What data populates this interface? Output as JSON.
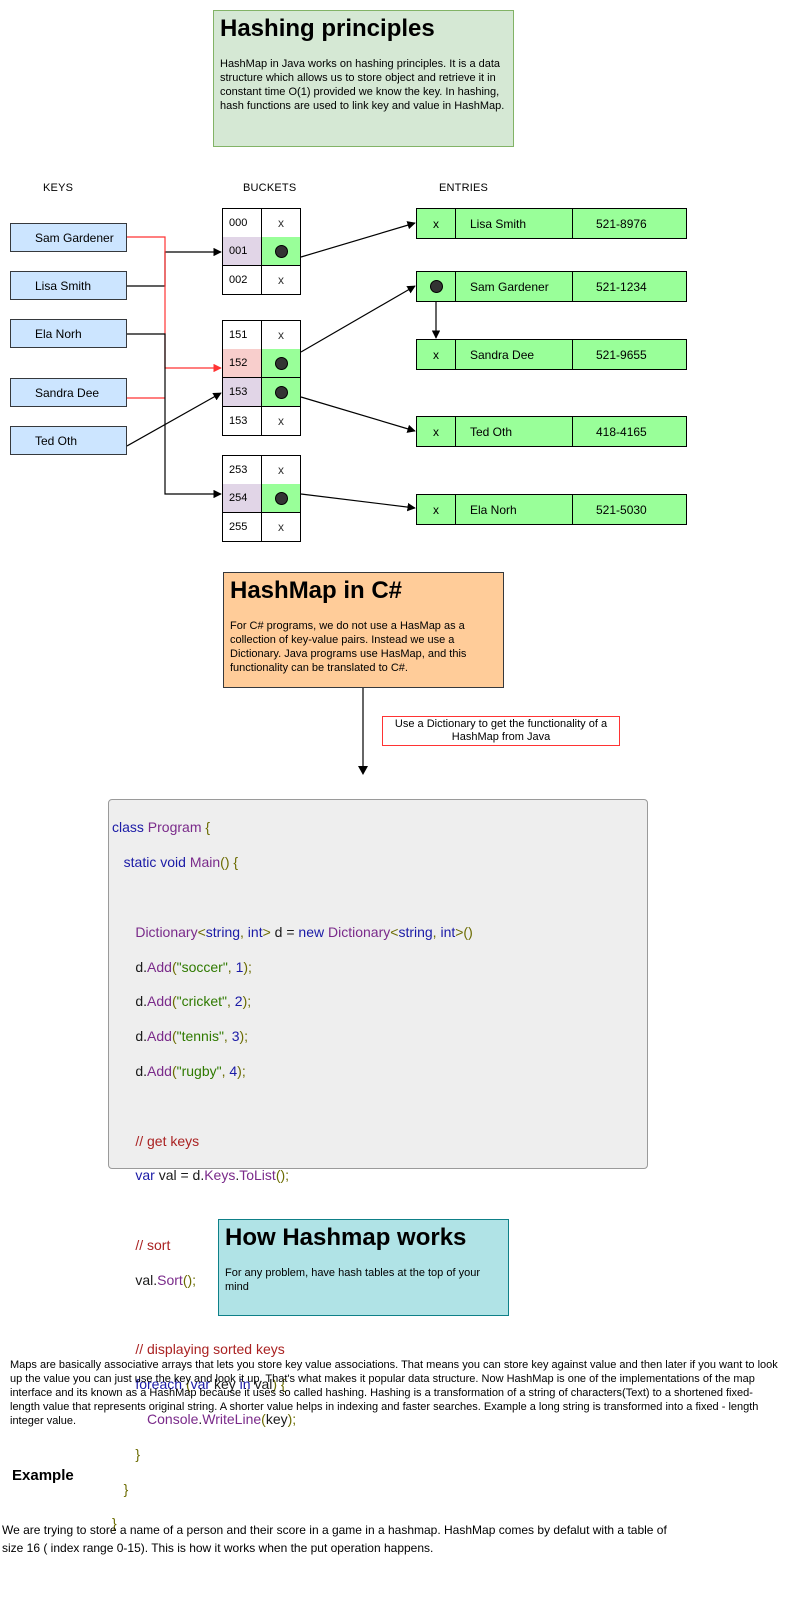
{
  "hashing_note": {
    "title": "Hashing principles",
    "body": "HashMap in Java works on hashing principles. It is a data structure which allows us to store object and retrieve it in constant time O(1) provided we know the key. In hashing, hash functions are used to link key and value in HashMap."
  },
  "diagram": {
    "keys_header": "KEYS",
    "buckets_header": "BUCKETS",
    "entries_header": "ENTRIES",
    "keys": [
      "Sam Gardener",
      "Lisa Smith",
      "Ela Norh",
      "Sandra Dee",
      "Ted Oth"
    ],
    "buckets": [
      {
        "num": "000",
        "val": "x",
        "dot": false,
        "highlight": ""
      },
      {
        "num": "001",
        "val": "",
        "dot": true,
        "highlight": "#e1d5e7"
      },
      {
        "num": "002",
        "val": "x",
        "dot": false,
        "highlight": ""
      },
      {
        "num": "151",
        "val": "x",
        "dot": false,
        "highlight": ""
      },
      {
        "num": "152",
        "val": "",
        "dot": true,
        "highlight": "#f8cecc"
      },
      {
        "num": "153",
        "val": "",
        "dot": true,
        "highlight": "#e1d5e7"
      },
      {
        "num": "153",
        "val": "x",
        "dot": false,
        "highlight": ""
      },
      {
        "num": "253",
        "val": "x",
        "dot": false,
        "highlight": ""
      },
      {
        "num": "254",
        "val": "",
        "dot": true,
        "highlight": "#e1d5e7"
      },
      {
        "num": "255",
        "val": "x",
        "dot": false,
        "highlight": ""
      }
    ],
    "entries": [
      {
        "next": "x",
        "name": "Lisa Smith",
        "phone": "521-8976",
        "dot": false
      },
      {
        "next": "",
        "name": "Sam Gardener",
        "phone": "521-1234",
        "dot": true
      },
      {
        "next": "x",
        "name": "Sandra Dee",
        "phone": "521-9655",
        "dot": false
      },
      {
        "next": "x",
        "name": "Ted Oth",
        "phone": "418-4165",
        "dot": false
      },
      {
        "next": "x",
        "name": "Ela Norh",
        "phone": "521-5030",
        "dot": false
      }
    ],
    "colors": {
      "key_fill": "#cce5ff",
      "entry_fill": "#99ff99",
      "collision_line": "#ff3333"
    }
  },
  "csharp_note": {
    "title": "HashMap in C#",
    "body": "For C# programs, we do not use a HasMap as a collection of key-value pairs. Instead we use a Dictionary. Java programs use HasMap, and this functionality can be translated to C#."
  },
  "dictionary_label": "Use a Dictionary to get the functionality of a HashMap from Java",
  "code_lines": [
    "class Program {",
    "   static void Main() {",
    "",
    "      Dictionary<string, int> d = new Dictionary<string, int>()",
    "      d.Add(\"soccer\", 1);",
    "      d.Add(\"cricket\", 2);",
    "      d.Add(\"tennis\", 3);",
    "      d.Add(\"rugby\", 4);",
    "",
    "      // get keys",
    "      var val = d.Keys.ToList();",
    "",
    "      // sort",
    "      val.Sort();",
    "",
    "      // displaying sorted keys",
    "      foreach (var key in val) {",
    "         Console.WriteLine(key);",
    "      }",
    "   }",
    "}"
  ],
  "how_note": {
    "title": "How Hashmap works",
    "body": "For any problem, have hash tables at the top of your mind"
  },
  "maps_paragraph": "Maps are basically  associative arrays that lets you store key value associations. That means you can store key against value and then later if you want to look up the value you can just use the key and look it up. That's what makes it  popular data structure.  Now HashMap is one of the implementations of the map interface and its known as a HashMap because it uses so called hashing. Hashing is a transformation of a string of characters(Text) to a shortened fixed-length value that represents original string. A shorter value helps in indexing and faster searches. Example a long string is transformed into a fixed - length integer value.",
  "example_heading": "Example",
  "example_paragraph": "We are trying to store a name of a person and their score in a game in a hashmap. HashMap comes by defalut with a table of size 16 ( index range 0-15). This is how it works when the put operation happens."
}
